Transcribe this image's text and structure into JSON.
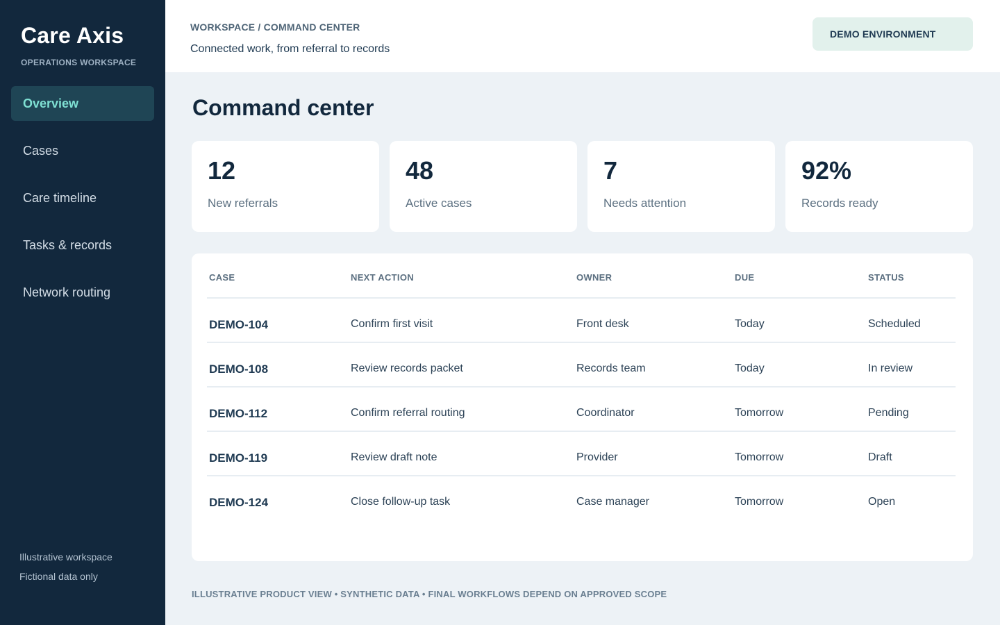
{
  "sidebar": {
    "brand_title": "Care Axis",
    "brand_subtitle": "OPERATIONS WORKSPACE",
    "items": [
      {
        "label": "Overview",
        "active": true
      },
      {
        "label": "Cases",
        "active": false
      },
      {
        "label": "Care timeline",
        "active": false
      },
      {
        "label": "Tasks & records",
        "active": false
      },
      {
        "label": "Network routing",
        "active": false
      }
    ],
    "footer": [
      "Illustrative workspace",
      "Fictional data only"
    ]
  },
  "header": {
    "breadcrumb": "WORKSPACE / COMMAND CENTER",
    "subtitle": "Connected work, from referral to records",
    "environment_badge": "DEMO ENVIRONMENT"
  },
  "main": {
    "title": "Command center",
    "stats": [
      {
        "value": "12",
        "label": "New referrals"
      },
      {
        "value": "48",
        "label": "Active cases"
      },
      {
        "value": "7",
        "label": "Needs attention"
      },
      {
        "value": "92%",
        "label": "Records ready"
      }
    ],
    "table": {
      "headers": [
        "CASE",
        "NEXT ACTION",
        "OWNER",
        "DUE",
        "STATUS"
      ],
      "rows": [
        [
          "DEMO-104",
          "Confirm first visit",
          "Front desk",
          "Today",
          "Scheduled"
        ],
        [
          "DEMO-108",
          "Review records packet",
          "Records team",
          "Today",
          "In review"
        ],
        [
          "DEMO-112",
          "Confirm referral routing",
          "Coordinator",
          "Tomorrow",
          "Pending"
        ],
        [
          "DEMO-119",
          "Review draft note",
          "Provider",
          "Tomorrow",
          "Draft"
        ],
        [
          "DEMO-124",
          "Close follow-up task",
          "Case manager",
          "Tomorrow",
          "Open"
        ]
      ]
    },
    "disclaimer": "ILLUSTRATIVE PRODUCT VIEW • SYNTHETIC DATA • FINAL WORKFLOWS DEPEND ON APPROVED SCOPE"
  },
  "colors": {
    "sidebar_bg": "#12283d",
    "active_nav_bg": "#1f4555",
    "active_nav_text": "#7fe0d3",
    "page_bg": "#edf2f6",
    "badge_bg": "#e2f1ec"
  }
}
